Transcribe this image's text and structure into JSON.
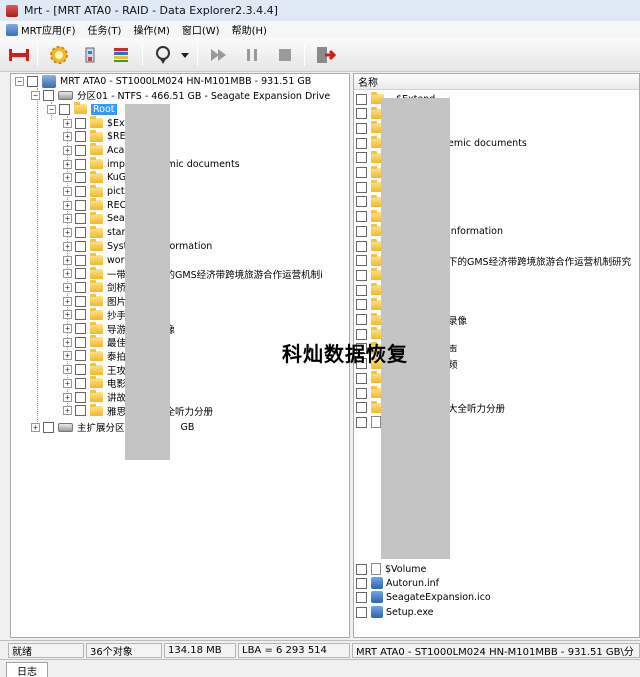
{
  "window": {
    "title": "Mrt - [MRT ATA0 - RAID - Data Explorer2.3.4.4]"
  },
  "menubar": {
    "items": [
      {
        "label": "MRT应用(F)"
      },
      {
        "label": "任务(T)"
      },
      {
        "label": "操作(M)"
      },
      {
        "label": "窗口(W)"
      },
      {
        "label": "帮助(H)"
      }
    ]
  },
  "toolbar": {
    "buttons": [
      {
        "icon": "disk-connect-icon"
      },
      {
        "icon": "settings-gear-icon"
      },
      {
        "icon": "tools-icon"
      },
      {
        "icon": "color-bars-icon"
      },
      {
        "icon": "recover-icon"
      },
      {
        "icon": "dropdown-arrow-icon"
      },
      {
        "icon": "play-icon"
      },
      {
        "icon": "pause-icon"
      },
      {
        "icon": "stop-icon"
      },
      {
        "icon": "exit-icon"
      }
    ]
  },
  "tree": {
    "disk_label": "MRT ATA0 - ST1000LM024 HN-M101MBB - 931.51 GB",
    "partition_label": "分区01 - NTFS - 466.51 GB - Seagate Expansion Drive",
    "root_label": "Root",
    "folders": [
      {
        "label": "$Ext"
      },
      {
        "label": "$RE"
      },
      {
        "label": "Aca"
      },
      {
        "label": "impo",
        "suffix": "emic documents"
      },
      {
        "label": "KuG"
      },
      {
        "label": "pictu"
      },
      {
        "label": "REC"
      },
      {
        "label": "Sea"
      },
      {
        "label": "star"
      },
      {
        "label": "Syst",
        "suffix": "Information"
      },
      {
        "label": "work"
      },
      {
        "label": "一带",
        "suffix": "下的GMS经济带跨境旅游合作运营机制i"
      },
      {
        "label": "剑桥"
      },
      {
        "label": "图片"
      },
      {
        "label": "抄手"
      },
      {
        "label": "导游",
        "suffix": "录像"
      },
      {
        "label": "最佳"
      },
      {
        "label": "泰拍",
        "suffix": "声"
      },
      {
        "label": "王攻",
        "suffix": "频"
      },
      {
        "label": "电影"
      },
      {
        "label": "讲故"
      },
      {
        "label": "雅思",
        "suffix": "大全听力分册"
      }
    ],
    "extended_partition_label": "主扩展分区",
    "extended_partition_suffix": "GB"
  },
  "right_panel": {
    "column_header": "名称",
    "partial_rows": [
      {
        "text": "$Extend",
        "row": 0
      },
      {
        "text": "emic documents",
        "row": 3
      },
      {
        "text": "Information",
        "row": 9
      },
      {
        "text": "下的GMS经济带跨境旅游合作运营机制研究",
        "row": 11
      },
      {
        "text": "录像",
        "row": 15
      },
      {
        "text": "声",
        "row": 17
      },
      {
        "text": "频",
        "row": 18
      },
      {
        "text": "大全听力分册",
        "row": 21
      }
    ],
    "files": [
      {
        "name": "$Volume",
        "icon": "blank-file-icon"
      },
      {
        "name": "Autorun.inf",
        "icon": "settings-file-icon"
      },
      {
        "name": "SeagateExpansion.ico",
        "icon": "image-file-icon"
      },
      {
        "name": "Setup.exe",
        "icon": "exe-file-icon"
      }
    ]
  },
  "watermark": {
    "text": "科灿数据恢复"
  },
  "statusbar": {
    "state": "就绪",
    "object_count": "36个对象",
    "size": "134.18 MB",
    "lba": "LBA = 6 293 514",
    "disk_info": "MRT ATA0 - ST1000LM024 HN-M101MBB - 931.51 GB\\分"
  },
  "bottom_tabs": {
    "log_label": "日志"
  }
}
